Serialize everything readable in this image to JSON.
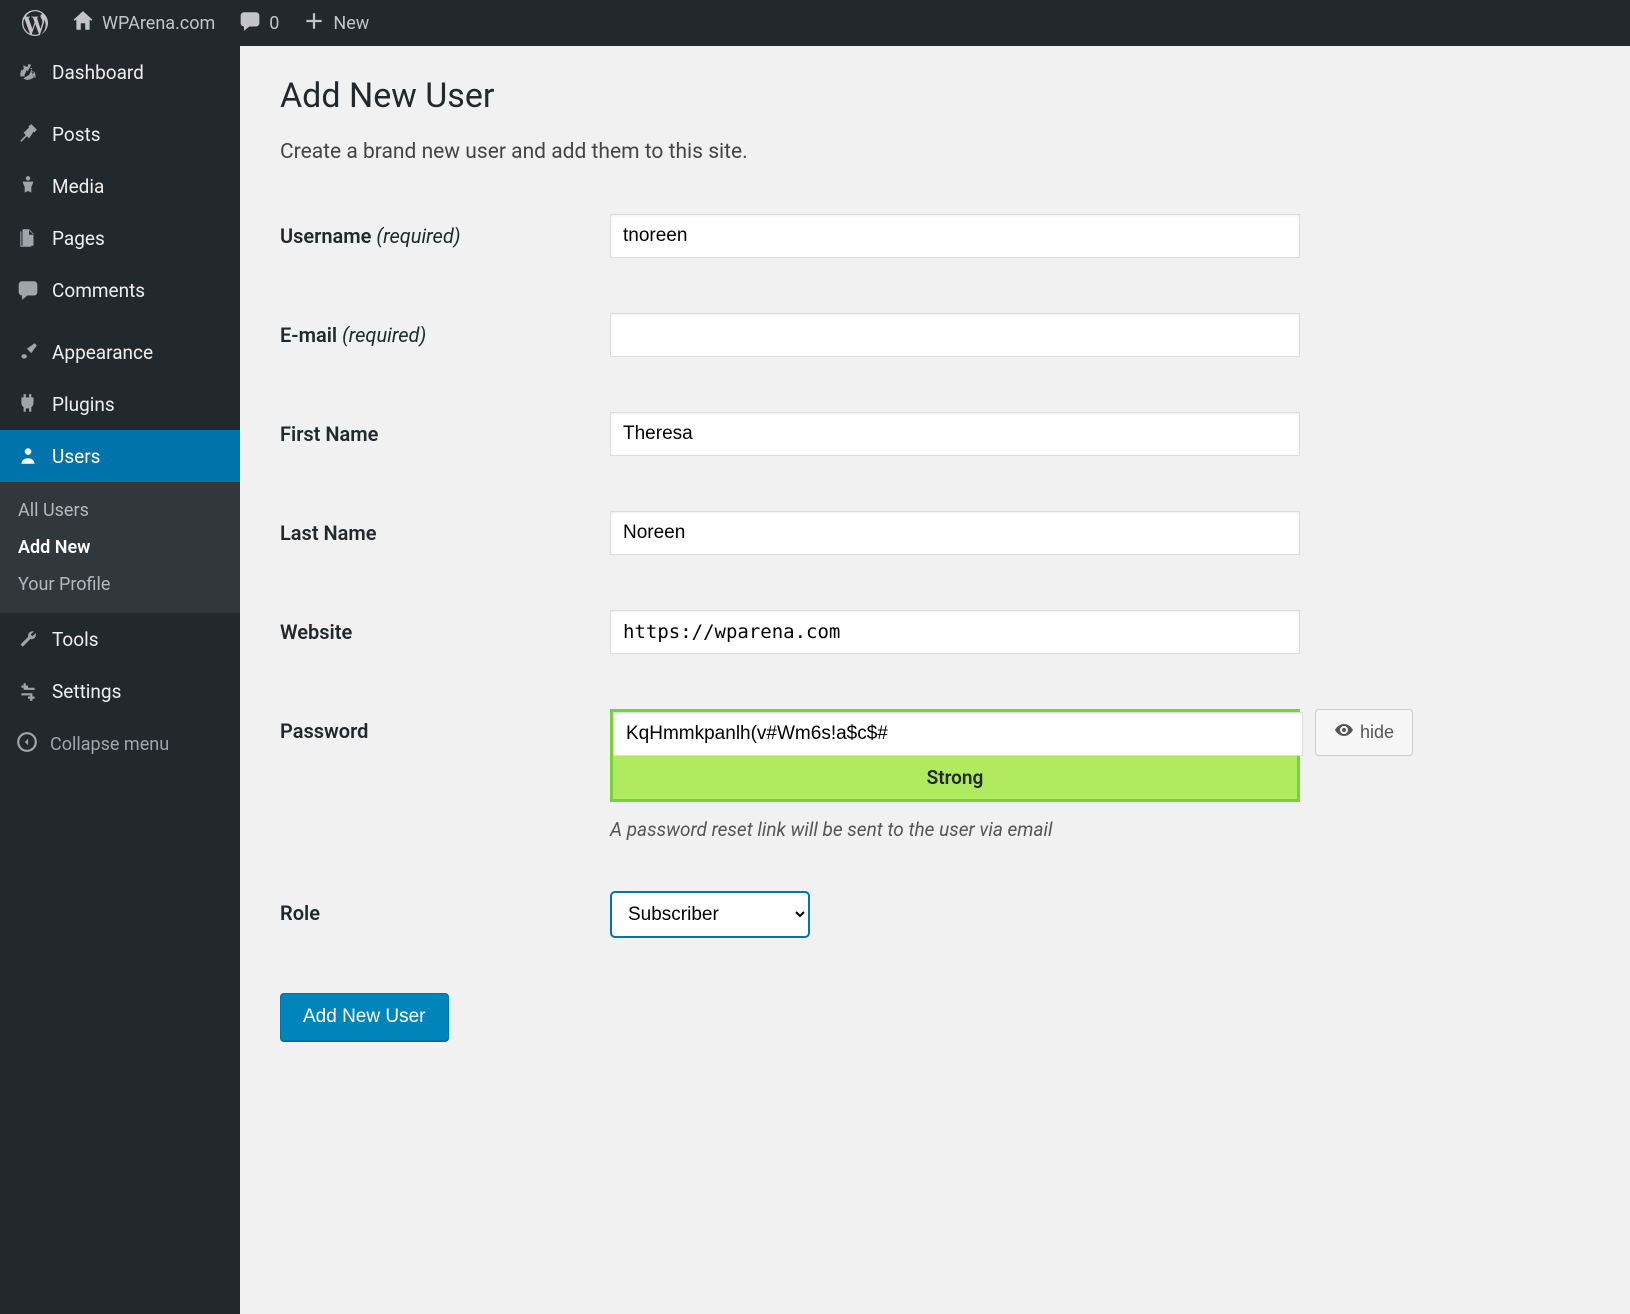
{
  "topbar": {
    "site_name": "WPArena.com",
    "comments_count": "0",
    "new_label": "New"
  },
  "sidebar": {
    "dashboard": "Dashboard",
    "posts": "Posts",
    "media": "Media",
    "pages": "Pages",
    "comments": "Comments",
    "appearance": "Appearance",
    "plugins": "Plugins",
    "users": "Users",
    "tools": "Tools",
    "settings": "Settings",
    "collapse": "Collapse menu",
    "submenu": {
      "all_users": "All Users",
      "add_new": "Add New",
      "your_profile": "Your Profile"
    }
  },
  "page": {
    "title": "Add New User",
    "description": "Create a brand new user and add them to this site."
  },
  "form": {
    "username_label": "Username",
    "username_required": "(required)",
    "username_value": "tnoreen",
    "email_label": "E-mail",
    "email_required": "(required)",
    "email_value": "",
    "firstname_label": "First Name",
    "firstname_value": "Theresa",
    "lastname_label": "Last Name",
    "lastname_value": "Noreen",
    "website_label": "Website",
    "website_value": "https://wparena.com",
    "password_label": "Password",
    "password_value": "KqHmmkpanlh(v#Wm6s!a$c$#",
    "password_strength": "Strong",
    "password_hide": "hide",
    "password_note": "A password reset link will be sent to the user via email",
    "role_label": "Role",
    "role_value": "Subscriber",
    "submit": "Add New User"
  }
}
